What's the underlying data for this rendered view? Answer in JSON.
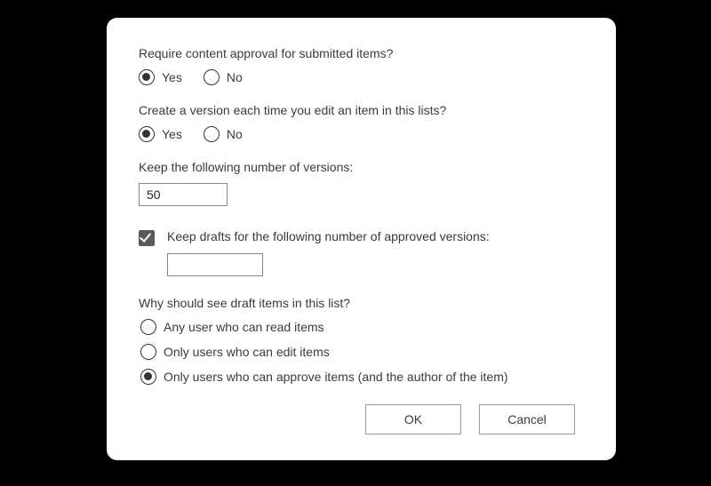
{
  "approval": {
    "question": "Require content approval for submitted items?",
    "yes_label": "Yes",
    "no_label": "No",
    "value": "yes"
  },
  "versioning": {
    "question": "Create a version each time you edit an item in this lists?",
    "yes_label": "Yes",
    "no_label": "No",
    "value": "yes"
  },
  "keep_versions": {
    "label": "Keep the following number of versions:",
    "value": "50"
  },
  "keep_drafts": {
    "checked": true,
    "label": "Keep drafts for the following number of approved versions:",
    "value": ""
  },
  "draft_visibility": {
    "question": "Why should see draft items in this list?",
    "options": [
      {
        "label": "Any user who can read items"
      },
      {
        "label": "Only users who can edit items"
      },
      {
        "label": "Only users who can approve items (and the author of the item)"
      }
    ],
    "selected_index": 2
  },
  "buttons": {
    "ok": "OK",
    "cancel": "Cancel"
  }
}
